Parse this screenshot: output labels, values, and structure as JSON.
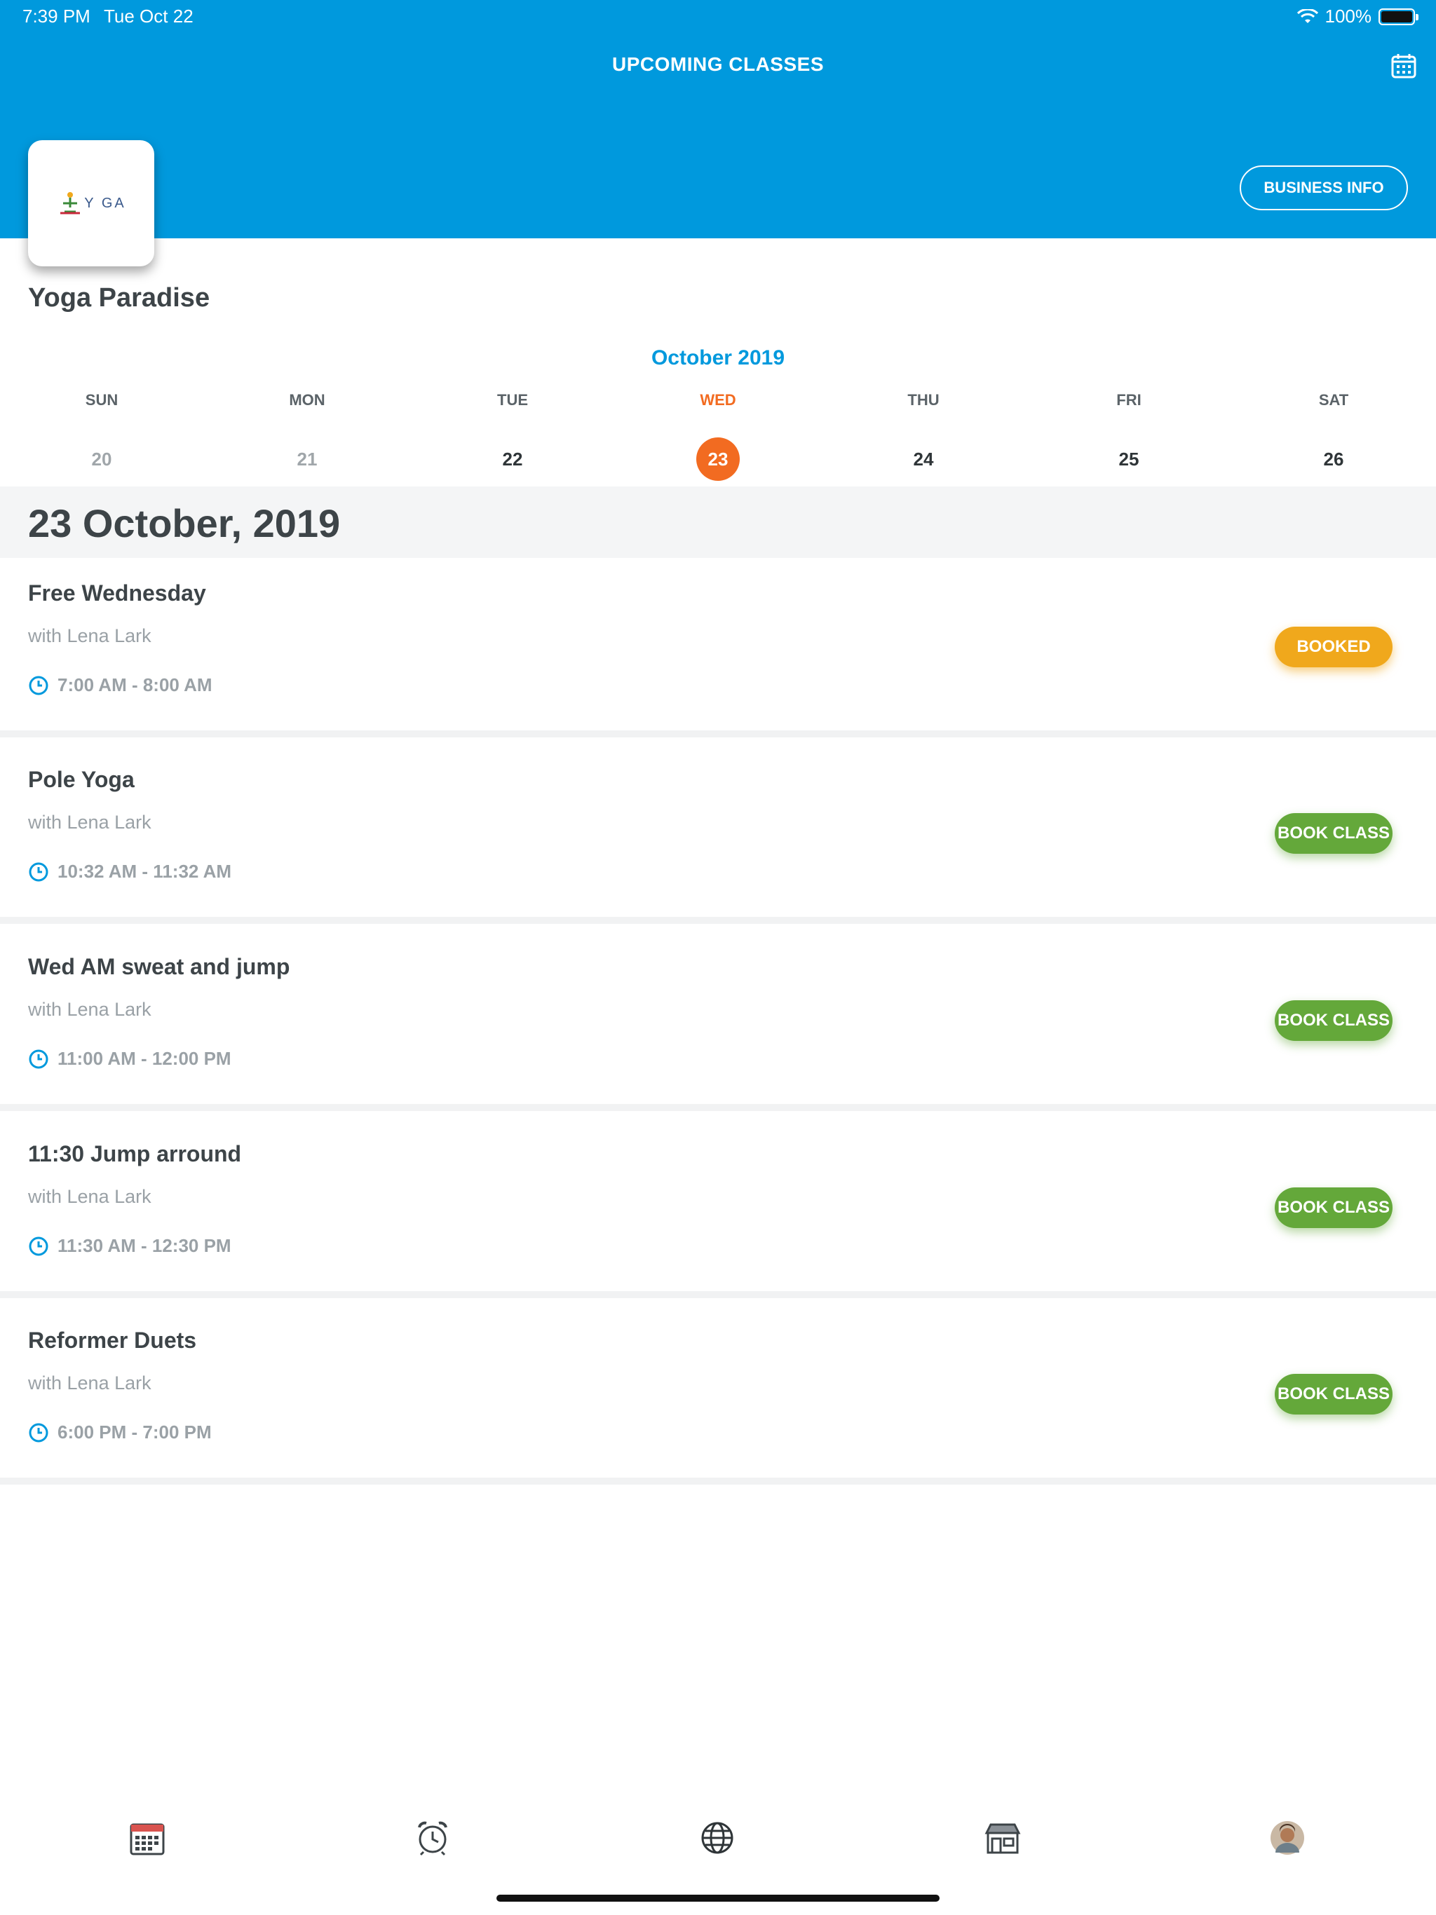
{
  "status_bar": {
    "time": "7:39 PM",
    "date": "Tue Oct 22",
    "battery": "100%"
  },
  "header": {
    "title": "UPCOMING CLASSES",
    "calendar_icon": "calendar-icon",
    "business_info_label": "BUSINESS INFO",
    "logo_text": "Y  GA"
  },
  "business": {
    "name": "Yoga Paradise"
  },
  "week": {
    "month_label": "October 2019",
    "days": [
      {
        "name": "SUN",
        "num": "20",
        "state": "past"
      },
      {
        "name": "MON",
        "num": "21",
        "state": "past"
      },
      {
        "name": "TUE",
        "num": "22",
        "state": "normal"
      },
      {
        "name": "WED",
        "num": "23",
        "state": "selected"
      },
      {
        "name": "THU",
        "num": "24",
        "state": "normal"
      },
      {
        "name": "FRI",
        "num": "25",
        "state": "normal"
      },
      {
        "name": "SAT",
        "num": "26",
        "state": "normal"
      }
    ]
  },
  "selected_date_heading": "23 October, 2019",
  "classes": [
    {
      "name": "Free Wednesday",
      "instructor": "with Lena Lark",
      "time": "7:00 AM - 8:00 AM",
      "action": "BOOKED",
      "status": "booked"
    },
    {
      "name": "Pole Yoga",
      "instructor": "with Lena Lark",
      "time": "10:32 AM - 11:32 AM",
      "action": "BOOK CLASS",
      "status": "book"
    },
    {
      "name": "Wed AM sweat and jump",
      "instructor": "with Lena Lark",
      "time": "11:00 AM - 12:00 PM",
      "action": "BOOK CLASS",
      "status": "book"
    },
    {
      "name": "11:30 Jump arround",
      "instructor": "with Lena Lark",
      "time": "11:30 AM - 12:30 PM",
      "action": "BOOK CLASS",
      "status": "book"
    },
    {
      "name": "Reformer Duets",
      "instructor": "with Lena Lark",
      "time": "6:00 PM - 7:00 PM",
      "action": "BOOK CLASS",
      "status": "book"
    }
  ],
  "tabbar": {
    "items": [
      "calendar-icon",
      "alarm-clock-icon",
      "globe-icon",
      "store-icon",
      "profile-avatar"
    ]
  },
  "colors": {
    "brand_blue": "#0099dd",
    "selected_orange": "#f26b21",
    "booked_yellow": "#f0a81c",
    "book_green": "#64a83a"
  }
}
